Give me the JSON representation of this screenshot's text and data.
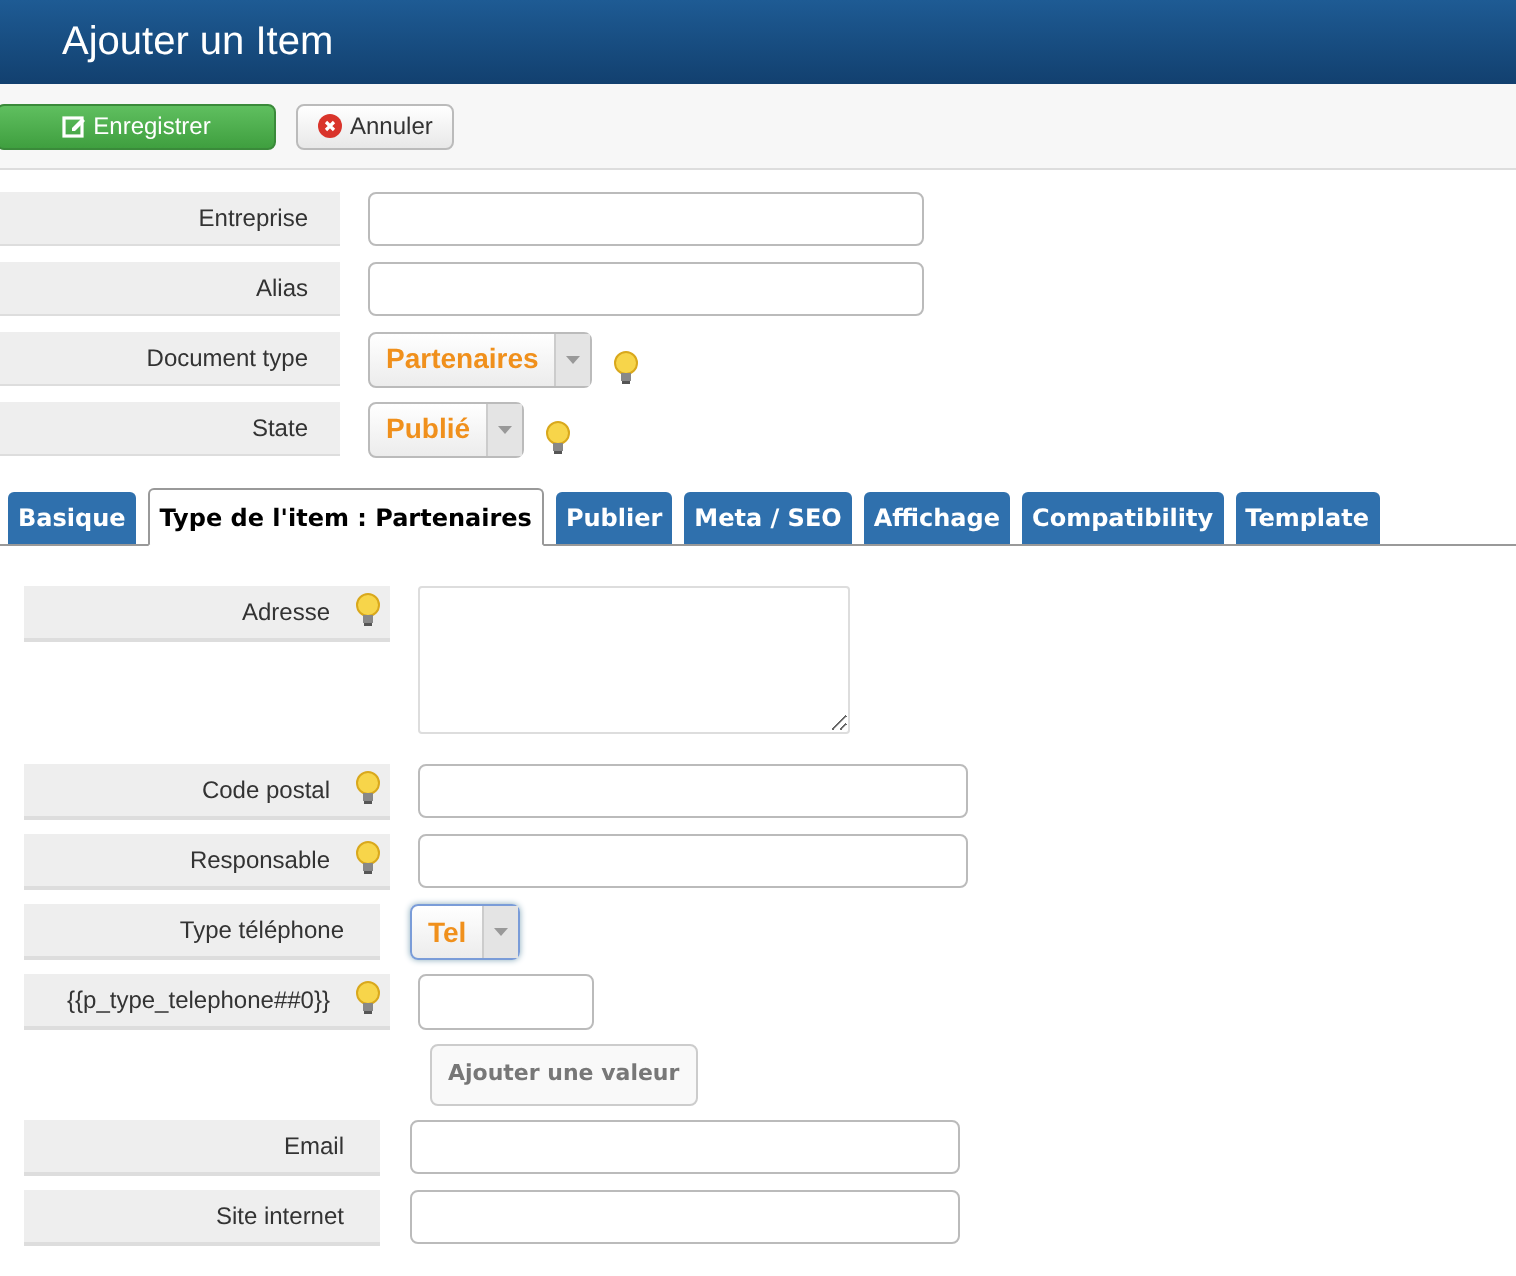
{
  "header": {
    "title": "Ajouter un Item"
  },
  "toolbar": [
    {
      "kind": "save",
      "label": "Enregistrer"
    },
    {
      "kind": "cancel",
      "label": "Annuler"
    }
  ],
  "fields": [
    {
      "kind": "text",
      "label": "Entreprise"
    },
    {
      "kind": "text",
      "label": "Alias"
    },
    {
      "kind": "select",
      "label": "Document type",
      "value": "Partenaires",
      "hint": true
    },
    {
      "kind": "select",
      "label": "State",
      "value": "Publié",
      "hint": true
    }
  ],
  "tabs": [
    {
      "label": "Basique",
      "selected": false
    },
    {
      "label": "Type de l'item : Partenaires",
      "selected": true
    },
    {
      "label": "Publier",
      "selected": false
    },
    {
      "label": "Meta / SEO",
      "selected": false
    },
    {
      "label": "Affichage",
      "selected": false
    },
    {
      "label": "Compatibility",
      "selected": false
    },
    {
      "label": "Template",
      "selected": false
    }
  ],
  "tab_fields": [
    {
      "kind": "textarea",
      "label": "Adresse",
      "hint": true
    },
    {
      "kind": "text",
      "label": "Code postal",
      "hint": true
    },
    {
      "kind": "text",
      "label": "Responsable",
      "hint": true
    },
    {
      "kind": "select",
      "label": "Type téléphone",
      "value": "Tel",
      "hint": false,
      "focused": true
    },
    {
      "kind": "short",
      "label": "{{p_type_telephone##0}}",
      "hint": true
    },
    {
      "kind": "button",
      "label": "Ajouter une valeur"
    },
    {
      "kind": "text",
      "label": "Email",
      "hint": false
    },
    {
      "kind": "text",
      "label": "Site internet",
      "hint": false
    }
  ]
}
